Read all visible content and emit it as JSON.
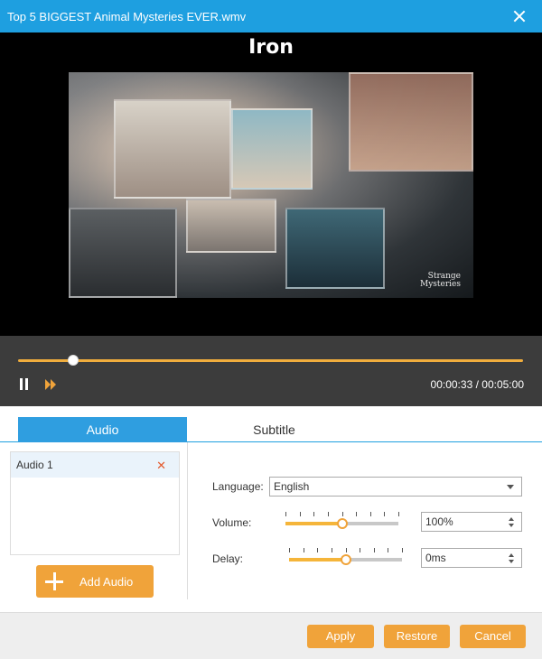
{
  "window": {
    "title": "Top 5 BIGGEST Animal Mysteries EVER.wmv"
  },
  "player": {
    "caption": "Iron",
    "watermark_line1": "Strange",
    "watermark_line2": "Mysteries"
  },
  "playback": {
    "current_time": "00:00:33",
    "separator": "/",
    "total_time": "00:05:00",
    "progress": 0.11
  },
  "tabs": [
    {
      "label": "Audio",
      "active": true
    },
    {
      "label": "Subtitle",
      "active": false
    }
  ],
  "audio_tracks": [
    {
      "label": "Audio 1"
    }
  ],
  "add_audio_label": "Add Audio",
  "settings": {
    "language_label": "Language:",
    "language_value": "English",
    "volume_label": "Volume:",
    "volume_value": "100%",
    "volume_level": 0.5,
    "delay_label": "Delay:",
    "delay_value": "0ms",
    "delay_level": 0.5
  },
  "footer": {
    "apply": "Apply",
    "restore": "Restore",
    "cancel": "Cancel"
  },
  "colors": {
    "titlebar": "#1e9fe0",
    "accent_orange": "#f0a33a",
    "controls_bg": "#3c3c3c"
  }
}
